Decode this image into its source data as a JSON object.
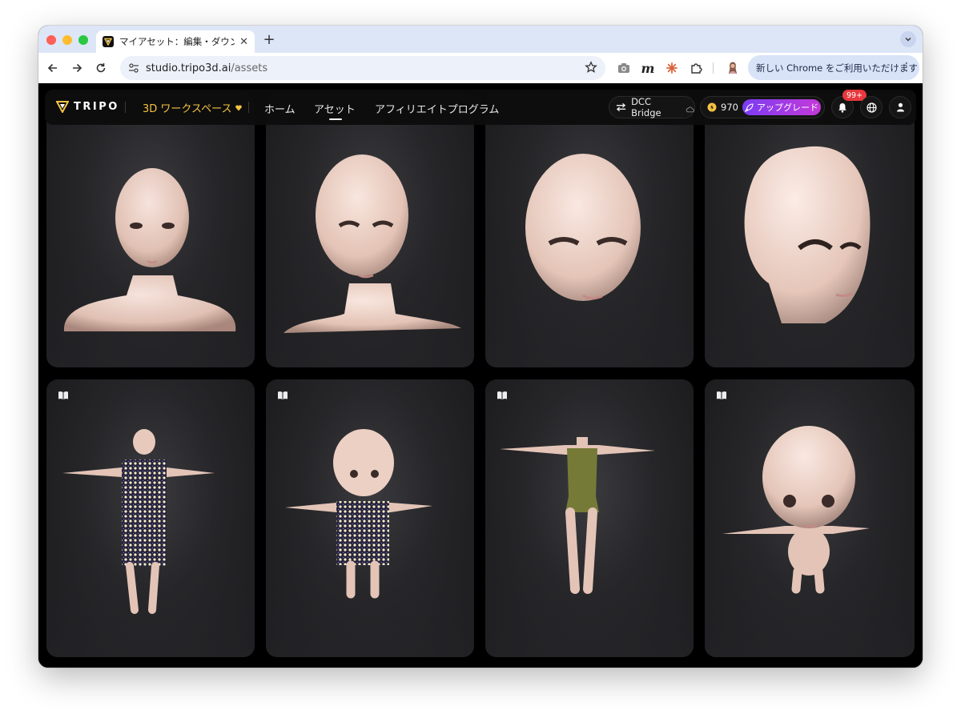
{
  "browser": {
    "tab_title": "マイアセット：編集・ダウンロ…",
    "new_tab_label": "+",
    "url_host": "studio.tripo3d.ai",
    "url_path": "/assets",
    "chrome_promo": "新しい Chrome をご利用いただけます",
    "extension_m": "m",
    "icons": [
      "back-icon",
      "forward-icon",
      "reload-icon",
      "site-settings-icon",
      "bookmark-star-icon",
      "camera-icon",
      "m-extension-icon",
      "claude-extension-icon",
      "puzzle-icon",
      "profile-avatar",
      "kebab-icon"
    ]
  },
  "app": {
    "logo_text": "TRIPO",
    "workspace_label": "3D ワークスペース",
    "nav": [
      "ホーム",
      "アセット",
      "アフィリエイトプログラム"
    ],
    "active_nav": "アセット",
    "dcc_bridge_label": "DCC Bridge",
    "credits": "970",
    "upgrade_label": "アップグレード",
    "notification_badge": "99+",
    "accent_color": "#f5c342",
    "upgrade_gradient": [
      "#7b3cf2",
      "#c43ad9"
    ]
  },
  "assets": {
    "row1": [
      "bust-head-1",
      "head-neck-2",
      "head-3",
      "head-side-4"
    ],
    "row2": [
      "t-pose-patterned-body",
      "chibi-t-pose",
      "headless-body-swimsuit",
      "big-head-chibi"
    ],
    "row2_icon": "book-icon"
  }
}
